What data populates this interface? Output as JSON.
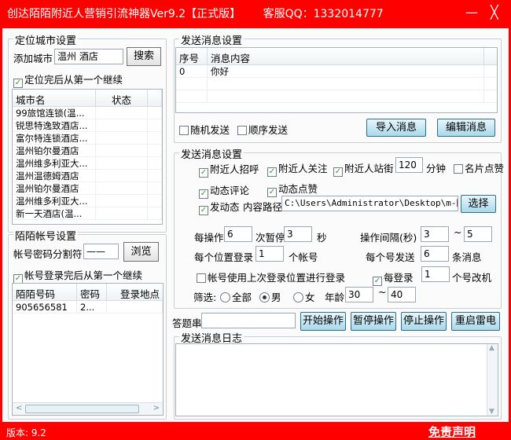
{
  "title": {
    "app": "创达陌陌附近人营销引流神器Ver9.2【正式版】",
    "service": "客服QQ：1332014777",
    "minimize": "—",
    "close": "╳"
  },
  "city": {
    "group": "定位城市设置",
    "add_label": "添加城市",
    "add_value": "温州 酒店",
    "search": "搜索",
    "continue_label": "定位完后从第一个继续",
    "continue_checked": true,
    "columns": [
      "城市名",
      "状态"
    ],
    "rows": [
      "99旅馆连锁(温...",
      "锐思特逸致酒店...",
      "富尔特连锁酒店...",
      "温州铂尔曼酒店",
      "温州维多利亚大...",
      "温州温德姆酒店",
      "温州铂尔曼酒店",
      "温州维多利亚大...",
      "新一天酒店(温..."
    ]
  },
  "account": {
    "group": "陌陌帐号设置",
    "sep_label": "帐号密码分割符",
    "sep_value": "——",
    "browse": "浏览",
    "continue_label": "帐号登录完后从第一个继续",
    "continue_checked": true,
    "columns": [
      "陌陌号码",
      "密码",
      "登录地点"
    ],
    "rows": [
      {
        "id": "905656581",
        "pwd": "2...",
        "loc": ""
      }
    ]
  },
  "messages": {
    "group": "发送消息设置",
    "columns": [
      "序号",
      "消息内容"
    ],
    "rows": [
      {
        "no": "0",
        "content": "你好"
      }
    ],
    "random_send": "随机发送",
    "order_send": "顺序发送",
    "import": "导入消息",
    "edit": "编辑消息"
  },
  "settings": {
    "group": "发送消息设置",
    "greet": "附近人招呼",
    "follow": "附近人关注",
    "stand": "附近人站街",
    "stand_minutes": "120",
    "minutes": "分钟",
    "card_like": "名片点赞",
    "comment": "动态评论",
    "like": "动态点赞",
    "post": "发动态",
    "path_label": "内容路径",
    "path_value": "C:\\Users\\Administrator\\Desktop\\m-陌陌",
    "choose": "选择",
    "every_op": "每操作",
    "every_op_value": "6",
    "pause": "次暂停",
    "pause_value": "3",
    "seconds": "秒",
    "interval": "操作间隔(秒)",
    "interval_min": "3",
    "tilde": "~",
    "interval_max": "5",
    "per_pos": "每个位置登录",
    "per_pos_value": "1",
    "accounts": "个帐号",
    "per_send": "每个号发送",
    "per_send_value": "6",
    "msgs": "条消息",
    "use_last": "帐号使用上次登录位置进行登录",
    "every_login": "每登录",
    "every_login_value": "1",
    "change": "个号改机",
    "filter": "筛选:",
    "all": "全部",
    "male": "男",
    "female": "女",
    "age": "年龄",
    "age_min": "30",
    "age_max": "40",
    "gender_selected": "男"
  },
  "actions": {
    "answer_label": "答题串",
    "answer_value": "",
    "start": "开始操作",
    "pause": "暂停操作",
    "stop": "停止操作",
    "restart": "重启雷电"
  },
  "log": {
    "group": "发送消息日志"
  },
  "status": {
    "version": "版本: 9.2",
    "disclaimer": "免责声明"
  }
}
